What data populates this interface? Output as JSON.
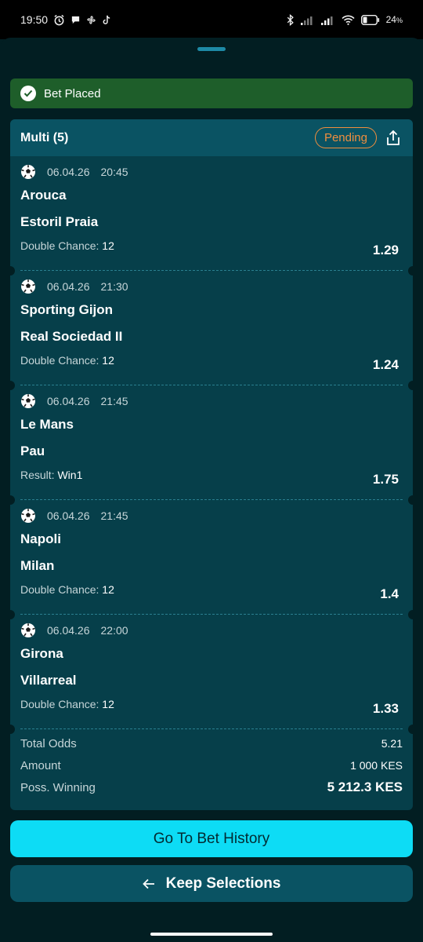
{
  "status_bar": {
    "time": "19:50",
    "battery": "24"
  },
  "toast": {
    "label": "Bet Placed"
  },
  "bet": {
    "title": "Multi (5)",
    "status": "Pending",
    "selections": [
      {
        "date": "06.04.26",
        "time": "20:45",
        "home": "Arouca",
        "away": "Estoril Praia",
        "market": "Double Chance:",
        "pick": "12",
        "odd": "1.29"
      },
      {
        "date": "06.04.26",
        "time": "21:30",
        "home": "Sporting Gijon",
        "away": "Real Sociedad II",
        "market": "Double Chance:",
        "pick": "12",
        "odd": "1.24"
      },
      {
        "date": "06.04.26",
        "time": "21:45",
        "home": "Le Mans",
        "away": "Pau",
        "market": "Result:",
        "pick": "Win1",
        "odd": "1.75"
      },
      {
        "date": "06.04.26",
        "time": "21:45",
        "home": "Napoli",
        "away": "Milan",
        "market": "Double Chance:",
        "pick": "12",
        "odd": "1.4"
      },
      {
        "date": "06.04.26",
        "time": "22:00",
        "home": "Girona",
        "away": "Villarreal",
        "market": "Double Chance:",
        "pick": "12",
        "odd": "1.33"
      }
    ],
    "summary": {
      "total_odds_label": "Total Odds",
      "total_odds": "5.21",
      "amount_label": "Amount",
      "amount": "1 000 KES",
      "winning_label": "Poss. Winning",
      "winning": "5 212.3 KES"
    }
  },
  "buttons": {
    "history": "Go To Bet History",
    "keep": "Keep Selections"
  },
  "colors": {
    "background": "#021e22",
    "card": "#063f4a",
    "accent": "#0ddcf5",
    "pending": "#f08e3e",
    "success": "#1e5e2a"
  },
  "icons": [
    "alarm-icon",
    "chat-icon",
    "fan-icon",
    "tiktok-icon",
    "bluetooth-icon",
    "signal-icon",
    "wifi-icon",
    "battery-icon",
    "check-icon",
    "share-icon",
    "soccer-ball-icon",
    "arrow-left-icon"
  ]
}
